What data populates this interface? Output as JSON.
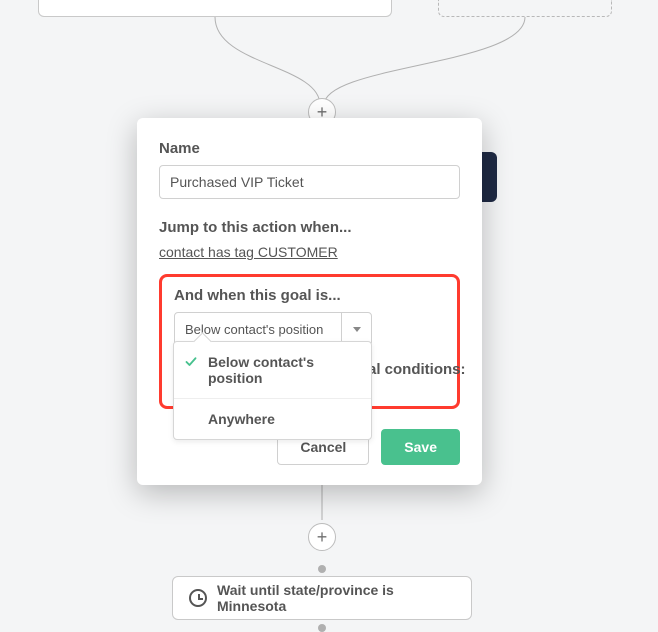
{
  "canvas": {
    "wait_card_text": "Wait until state/province is Minnesota"
  },
  "modal": {
    "name_label": "Name",
    "name_value": "Purchased VIP Ticket",
    "jump_label": "Jump to this action when...",
    "condition_text": "contact has tag CUSTOMER",
    "goal_label": "And when this goal is...",
    "select_value": "Below contact's position",
    "options": [
      {
        "label": "Below contact's position",
        "selected": true
      },
      {
        "label": "Anywhere",
        "selected": false
      }
    ],
    "behind_text": "al conditions:",
    "cancel": "Cancel",
    "save": "Save"
  }
}
